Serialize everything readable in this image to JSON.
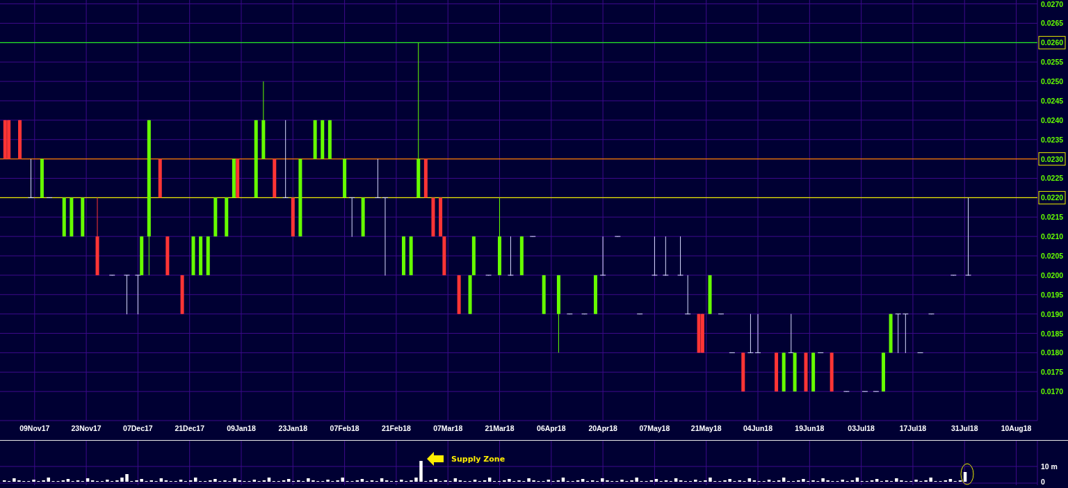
{
  "price_chart": {
    "chart_data": {
      "type": "bar",
      "grid": true,
      "categories": [
        "09Nov17",
        "23Nov17",
        "07Dec17",
        "21Dec17",
        "09Jan18",
        "23Jan18",
        "07Feb18",
        "21Feb18",
        "07Mar18",
        "21Mar18",
        "06Apr18",
        "20Apr18",
        "07May18",
        "21May18",
        "04Jun18",
        "19Jun18",
        "03Jul18",
        "17Jul18",
        "31Jul18",
        "10Aug18"
      ],
      "ylim": [
        0.01625,
        0.0271
      ],
      "yticks": [
        {
          "value": 0.027,
          "label": "0.0270"
        },
        {
          "value": 0.0265,
          "label": "0.0265"
        },
        {
          "value": 0.026,
          "label": "0.0260"
        },
        {
          "value": 0.0255,
          "label": "0.0255"
        },
        {
          "value": 0.025,
          "label": "0.0250"
        },
        {
          "value": 0.0245,
          "label": "0.0245"
        },
        {
          "value": 0.024,
          "label": "0.0240"
        },
        {
          "value": 0.0235,
          "label": "0.0235"
        },
        {
          "value": 0.023,
          "label": "0.0230"
        },
        {
          "value": 0.0225,
          "label": "0.0225"
        },
        {
          "value": 0.022,
          "label": "0.0220"
        },
        {
          "value": 0.0215,
          "label": "0.0215"
        },
        {
          "value": 0.021,
          "label": "0.0210"
        },
        {
          "value": 0.0205,
          "label": "0.0205"
        },
        {
          "value": 0.02,
          "label": "0.0200"
        },
        {
          "value": 0.0195,
          "label": "0.0195"
        },
        {
          "value": 0.019,
          "label": "0.0190"
        },
        {
          "value": 0.0185,
          "label": "0.0185"
        },
        {
          "value": 0.018,
          "label": "0.0180"
        },
        {
          "value": 0.0175,
          "label": "0.0175"
        },
        {
          "value": 0.017,
          "label": "0.0170"
        }
      ],
      "ref_lines": [
        {
          "axis": "y",
          "value": 0.026,
          "color": "#22ee22"
        },
        {
          "axis": "y",
          "value": 0.023,
          "color": "#ff7f00"
        },
        {
          "axis": "y",
          "value": 0.022,
          "color": "#eeee00"
        }
      ]
    }
  },
  "volume_panel": {
    "axis_labels": [
      "10 m",
      "0"
    ],
    "annotation": "Supply Zone"
  }
}
